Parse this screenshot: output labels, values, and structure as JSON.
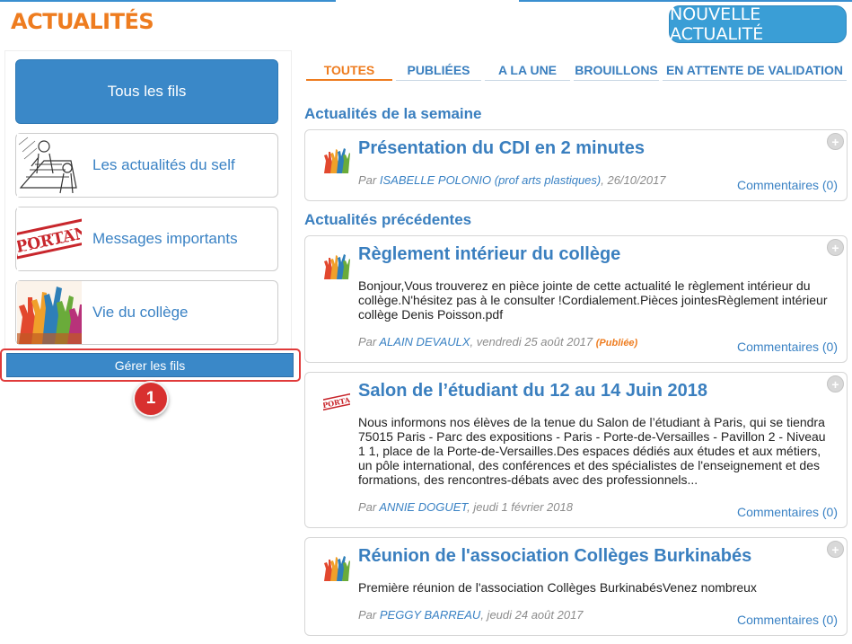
{
  "header": {
    "title": "ACTUALITÉS",
    "new_button": "NOUVELLE ACTUALITÉ"
  },
  "sidebar": {
    "feeds": [
      {
        "label": "Tous les fils",
        "icon": "all-feeds"
      },
      {
        "label": "Les actualités du self",
        "icon": "cafeteria-sketch-icon"
      },
      {
        "label": "Messages importants",
        "icon": "important-stamp-icon"
      },
      {
        "label": "Vie du collège",
        "icon": "raised-hands-icon"
      }
    ],
    "manage_button": "Gérer les fils",
    "step_badge": "1"
  },
  "tabs": [
    "TOUTES",
    "PUBLIÉES",
    "A LA UNE",
    "BROUILLONS",
    "EN ATTENTE DE VALIDATION"
  ],
  "sections": {
    "week": "Actualités de la semaine",
    "previous": "Actualités précédentes"
  },
  "posts": [
    {
      "title": "Présentation du CDI en 2 minutes",
      "body": "",
      "by": "Par",
      "author": "ISABELLE POLONIO (prof arts plastiques)",
      "date": ", 26/10/2017",
      "status": "",
      "comments": "Commentaires (0)",
      "icon": "raised-hands-icon"
    },
    {
      "title": "Règlement intérieur du collège",
      "body": "Bonjour,Vous trouverez en pièce jointe de cette actualité le règlement intérieur du collège.N'hésitez pas à le consulter !Cordialement.Pièces jointesRèglement intérieur collège Denis Poisson.pdf",
      "by": "Par",
      "author": "ALAIN DEVAULX",
      "date": ", vendredi 25 août 2017",
      "status": "(Publiée)",
      "comments": "Commentaires (0)",
      "icon": "raised-hands-icon"
    },
    {
      "title": "Salon de l’étudiant du 12 au 14 Juin 2018",
      "body": "Nous informons nos élèves de la tenue du Salon de l’étudiant à Paris, qui se tiendra 75015 Paris - Parc des expositions - Paris - Porte-de-Versailles - Pavillon 2 - Niveau 1 1, place de la Porte-de-Versailles.Des espaces dédiés aux études et aux métiers, un pôle international, des conférences et des spécialistes de l'enseignement et des formations, des rencontres-débats avec des professionnels...",
      "by": "Par",
      "author": "ANNIE DOGUET",
      "date": ", jeudi 1 février 2018",
      "status": "",
      "comments": "Commentaires (0)",
      "icon": "important-stamp-icon"
    },
    {
      "title": "Réunion de l'association Collèges Burkinabés",
      "body": "Première réunion de l'association Collèges BurkinabésVenez nombreux",
      "by": "Par",
      "author": "PEGGY BARREAU",
      "date": ", jeudi 24 août 2017",
      "status": "",
      "comments": "Commentaires (0)",
      "icon": "raised-hands-icon"
    }
  ],
  "colors": {
    "accent_orange": "#ee7c1f",
    "primary_blue": "#3a88c8",
    "link_blue": "#3a7fbf",
    "highlight_red": "#e03a3a"
  }
}
